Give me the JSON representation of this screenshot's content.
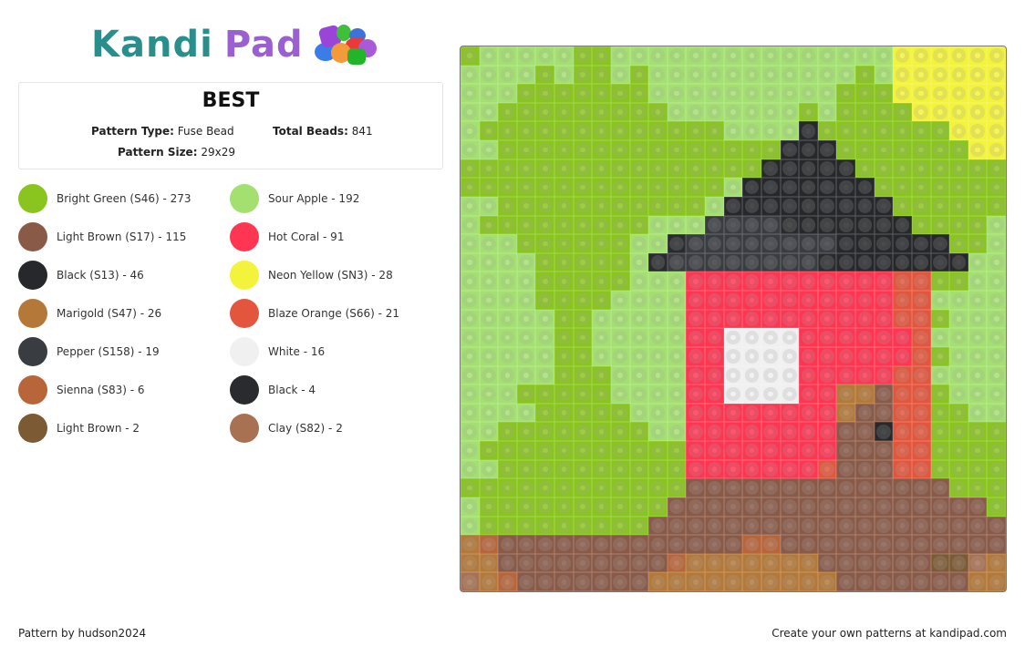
{
  "logo": {
    "part1": "Kandi",
    "part2": "Pad"
  },
  "pattern": {
    "title": "BEST",
    "type_label": "Pattern Type:",
    "type_value": "Fuse Bead",
    "total_label": "Total Beads:",
    "total_value": "841",
    "size_label": "Pattern Size:",
    "size_value": "29x29"
  },
  "legend": [
    {
      "code": "B",
      "label": "Bright Green (S46) - 273",
      "color": "#8ac41f"
    },
    {
      "code": "S",
      "label": "Sour Apple - 192",
      "color": "#a4e070"
    },
    {
      "code": "L",
      "label": "Light Brown (S17) - 115",
      "color": "#8a5a48"
    },
    {
      "code": "C",
      "label": "Hot Coral - 91",
      "color": "#fe3652"
    },
    {
      "code": "K",
      "label": "Black (S13) - 46",
      "color": "#27282b"
    },
    {
      "code": "Y",
      "label": "Neon Yellow (SN3) - 28",
      "color": "#f3f33c"
    },
    {
      "code": "M",
      "label": "Marigold (S47) - 26",
      "color": "#b47838"
    },
    {
      "code": "O",
      "label": "Blaze Orange (S66) - 21",
      "color": "#e3553c"
    },
    {
      "code": "P",
      "label": "Pepper (S158) - 19",
      "color": "#393c40"
    },
    {
      "code": "W",
      "label": "White - 16",
      "color": "#f0f0f0"
    },
    {
      "code": "N",
      "label": "Sienna (S83) - 6",
      "color": "#b8653a"
    },
    {
      "code": "X",
      "label": "Black - 4",
      "color": "#2a2b2e"
    },
    {
      "code": "D",
      "label": "Light Brown - 2",
      "color": "#7c5a34"
    },
    {
      "code": "Z",
      "label": "Clay (S82) - 2",
      "color": "#a87252"
    }
  ],
  "grid": [
    "BSSSSSBBSSSSSSSSSSSSSSSYYYYYY",
    "SSSSBSBBSBSSSSSSSSSSSBSYYYYYY",
    "SSSBBBBBBBSSSSSSSSSSBBBYYYYYY",
    "SSBBBBBBBBBSSSSSSSBSBBBBYYYYY",
    "SBBBBBBBBBBBBBSSSSKBBBBBBBYYY",
    "SSBBBBBBBBBBBBBBBKKKBBBBBBBYY",
    "BBBBBBBBBBBBBBBBKKKKKBBBBBBBB",
    "BBBBBBBBBBBBBBSKKKKKKKBBBBBBB",
    "SSBBBBBBBBBBBSKKKKKKKKKBBBBBB",
    "SBBBBBBBBBSSSPPPPXKKKKKKBBBBS",
    "SSSBBBBBBSSXPPPPPPPPKKKKKKBBS",
    "SSSSBBBBBSXPPPPPPPPXKKKKKKKSS",
    "SSSSBBBBBSSSCCCCCCCCCCCOOBBSS",
    "SSSSBBBBSSSSCCCCCCCCCCCOOSSSS",
    "SSSSSBBSSSSSCCCCCCCCCCCOOBSSS",
    "SSSSSBBSSSSSCCWWWWCCCCCCOSSSS",
    "SSSSSBBSSSSSCCWWWWCCCCCCOBSSS",
    "SSSSSBBBSSSSCCWWWWCCCCCOOSSSS",
    "SSSBBBBBSSSSCCWWWWCCMMLOOBSSS",
    "SSSSBBBBBSSSCCCCCCCCMLLOOBBSS",
    "SSBBBBBBBBSSCCCCCCCCLLKOOBBBB",
    "SBBBBBBBBBBBCCCCCCCCLLLOOBBBB",
    "SSBBBBBBBBBBCCCCCCCOLLLOOBBBB",
    "BBBBBBBBBBBBLLLLLLLLLLLLLLBBB",
    "SBBBBBBBBBBLLLLLLLLLLLLLLLLLB",
    "SBBBBBBBBBLLLLLLLLLLLLLLLLLLL",
    "MNLLLLLLLLLLLLLNNLLLLLLLLLLLL",
    "MMLLLLLLLLLNMMMMMMMLLLLLLDDZM",
    "ZMNLLLLLLLMMMMMMMMMMLLLLLLLMM"
  ],
  "footer": {
    "credit": "Pattern by hudson2024",
    "cta": "Create your own patterns at kandipad.com"
  }
}
